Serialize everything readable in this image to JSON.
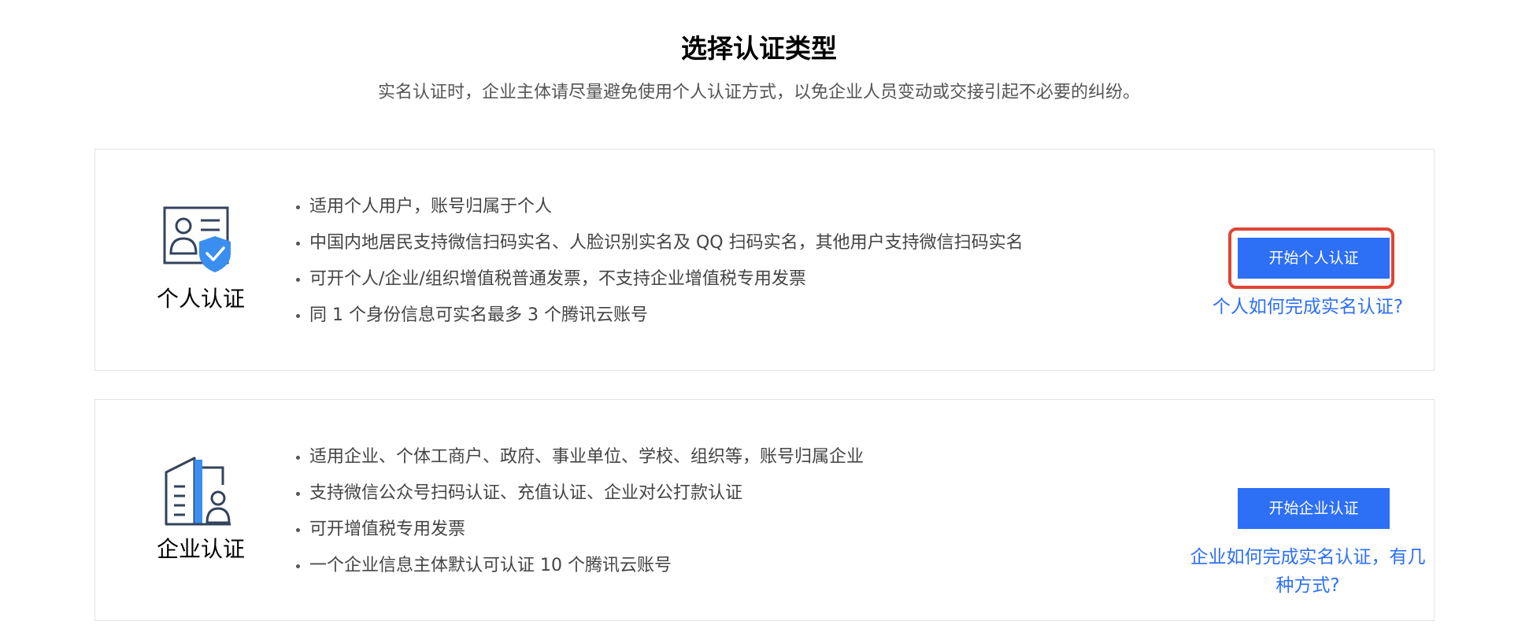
{
  "header": {
    "title": "选择认证类型",
    "subtitle": "实名认证时，企业主体请尽量避免使用个人认证方式，以免企业人员变动或交接引起不必要的纠纷。"
  },
  "personal": {
    "icon": "personal-id-shield-icon",
    "label": "个人认证",
    "features": [
      "适用个人用户，账号归属于个人",
      "中国内地居民支持微信扫码实名、人脸识别实名及 QQ 扫码实名，其他用户支持微信扫码实名",
      "可开个人/企业/组织增值税普通发票，不支持企业增值税专用发票",
      "同 1 个身份信息可实名最多 3 个腾讯云账号"
    ],
    "button_label": "开始个人认证",
    "help_link": "个人如何完成实名认证?"
  },
  "enterprise": {
    "icon": "enterprise-building-icon",
    "label": "企业认证",
    "features": [
      "适用企业、个体工商户、政府、事业单位、学校、组织等，账号归属企业",
      "支持微信公众号扫码认证、充值认证、企业对公打款认证",
      "可开增值税专用发票",
      "一个企业信息主体默认可认证 10 个腾讯云账号"
    ],
    "button_label": "开始企业认证",
    "help_link": "企业如何完成实名认证，有几种方式?"
  },
  "colors": {
    "accent": "#2d6ff5",
    "highlight": "#e04534",
    "icon_dark": "#33435c"
  }
}
